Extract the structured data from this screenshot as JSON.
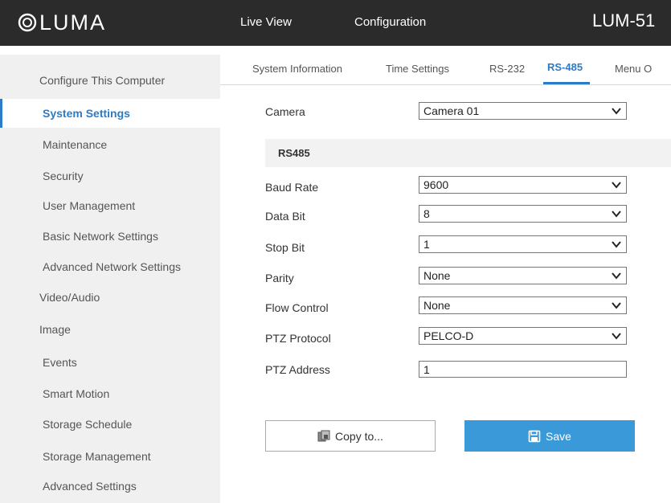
{
  "header": {
    "logo_text": "LUMA",
    "nav": [
      {
        "label": "Live View"
      },
      {
        "label": "Configuration"
      }
    ],
    "device_name": "LUM-51"
  },
  "sidebar": {
    "items": [
      {
        "label": "Configure This Computer"
      },
      {
        "label": "System Settings"
      },
      {
        "label": "Maintenance"
      },
      {
        "label": "Security"
      },
      {
        "label": "User Management"
      },
      {
        "label": "Basic Network Settings"
      },
      {
        "label": "Advanced Network Settings"
      },
      {
        "label": "Video/Audio"
      },
      {
        "label": "Image"
      },
      {
        "label": "Events"
      },
      {
        "label": "Smart Motion"
      },
      {
        "label": "Storage Schedule"
      },
      {
        "label": "Storage Management"
      },
      {
        "label": "Advanced Settings"
      }
    ]
  },
  "tabs": [
    {
      "label": "System Information"
    },
    {
      "label": "Time Settings"
    },
    {
      "label": "RS-232"
    },
    {
      "label": "RS-485"
    },
    {
      "label": "Menu O"
    }
  ],
  "form": {
    "camera": {
      "label": "Camera",
      "value": "Camera 01"
    },
    "section_title": "RS485",
    "baud_rate": {
      "label": "Baud Rate",
      "value": "9600"
    },
    "data_bit": {
      "label": "Data Bit",
      "value": "8"
    },
    "stop_bit": {
      "label": "Stop Bit",
      "value": "1"
    },
    "parity": {
      "label": "Parity",
      "value": "None"
    },
    "flow_control": {
      "label": "Flow Control",
      "value": "None"
    },
    "ptz_protocol": {
      "label": "PTZ Protocol",
      "value": "PELCO-D"
    },
    "ptz_address": {
      "label": "PTZ Address",
      "value": "1"
    }
  },
  "buttons": {
    "copy_label": "Copy to...",
    "save_label": "Save"
  },
  "colors": {
    "accent": "#2a7cc7",
    "save_button": "#3a9ad9",
    "topbar": "#2b2b2b",
    "sidebar_bg": "#f0f0f0"
  },
  "icons": {
    "logo": "luma-logo-icon",
    "dropdown": "chevron-down-icon",
    "copy": "copy-icon",
    "save": "floppy-disk-icon"
  }
}
